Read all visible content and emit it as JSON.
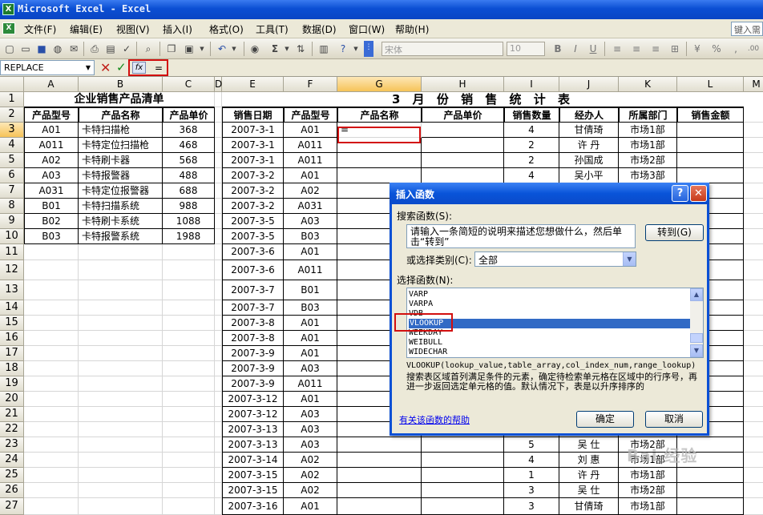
{
  "window": {
    "title": "Microsoft Excel - Excel",
    "app_icon": "excel-icon"
  },
  "menu": [
    "文件(F)",
    "编辑(E)",
    "视图(V)",
    "插入(I)",
    "格式(O)",
    "工具(T)",
    "数据(D)",
    "窗口(W)",
    "帮助(H)"
  ],
  "help_box": {
    "placeholder": "键入需"
  },
  "toolbar": {
    "font_name": "宋体",
    "font_size": "10",
    "icons": [
      "new-icon",
      "open-icon",
      "save-icon",
      "permission-icon",
      "email-icon",
      "print-icon",
      "print-preview-icon",
      "research-icon",
      "copy-icon",
      "paste-icon",
      "undo-icon",
      "hyperlink-icon",
      "autosum-icon",
      "sort-icon",
      "chart-icon",
      "help-icon",
      "bold-icon",
      "italic-icon",
      "underline-icon",
      "align-left-icon",
      "center-icon",
      "align-right-icon",
      "merge-center-icon",
      "currency-icon",
      "percent-icon",
      "comma-icon",
      "decimal-icon"
    ]
  },
  "formula_bar": {
    "name_box": "REPLACE",
    "cancel": "✕",
    "enter": "✓",
    "fx": "fx",
    "formula": "="
  },
  "columns": [
    "A",
    "B",
    "C",
    "D",
    "E",
    "F",
    "G",
    "H",
    "I",
    "J",
    "K",
    "L",
    "M"
  ],
  "rows": [
    "1",
    "2",
    "3",
    "4",
    "5",
    "6",
    "7",
    "8",
    "9",
    "10",
    "11",
    "12",
    "13",
    "14",
    "15",
    "16",
    "17",
    "18",
    "19",
    "20",
    "21",
    "22",
    "23",
    "24",
    "25",
    "26",
    "27"
  ],
  "left_table": {
    "title": "企业销售产品清单",
    "headers": [
      "产品型号",
      "产品名称",
      "产品单价"
    ],
    "rows": [
      [
        "A01",
        "卡特扫描枪",
        "368"
      ],
      [
        "A011",
        "卡特定位扫描枪",
        "468"
      ],
      [
        "A02",
        "卡特刷卡器",
        "568"
      ],
      [
        "A03",
        "卡特报警器",
        "488"
      ],
      [
        "A031",
        "卡特定位报警器",
        "688"
      ],
      [
        "B01",
        "卡特扫描系统",
        "988"
      ],
      [
        "B02",
        "卡特刷卡系统",
        "1088"
      ],
      [
        "B03",
        "卡特报警系统",
        "1988"
      ]
    ]
  },
  "right_table": {
    "title": "3 月 份 销 售 统 计 表",
    "headers": [
      "销售日期",
      "产品型号",
      "产品名称",
      "产品单价",
      "销售数量",
      "经办人",
      "所属部门",
      "销售金额"
    ],
    "active_cell_value": "=",
    "rows": [
      [
        "2007-3-1",
        "A01",
        "",
        "",
        "4",
        "甘倩琦",
        "市场1部",
        ""
      ],
      [
        "2007-3-1",
        "A011",
        "",
        "",
        "2",
        "许  丹",
        "市场1部",
        ""
      ],
      [
        "2007-3-1",
        "A011",
        "",
        "",
        "2",
        "孙国成",
        "市场2部",
        ""
      ],
      [
        "2007-3-2",
        "A01",
        "",
        "",
        "4",
        "吴小平",
        "市场3部",
        ""
      ],
      [
        "2007-3-2",
        "A02",
        "",
        "",
        "",
        "",
        "",
        ""
      ],
      [
        "2007-3-2",
        "A031",
        "",
        "",
        "",
        "",
        "",
        ""
      ],
      [
        "2007-3-5",
        "A03",
        "",
        "",
        "",
        "",
        "",
        ""
      ],
      [
        "2007-3-5",
        "B03",
        "",
        "",
        "",
        "",
        "",
        ""
      ],
      [
        "2007-3-6",
        "A01",
        "",
        "",
        "",
        "",
        "",
        ""
      ],
      [
        "2007-3-6",
        "A011",
        "",
        "",
        "",
        "",
        "",
        ""
      ],
      [
        "2007-3-7",
        "B01",
        "",
        "",
        "",
        "",
        "",
        ""
      ],
      [
        "2007-3-7",
        "B03",
        "",
        "",
        "",
        "",
        "",
        ""
      ],
      [
        "2007-3-8",
        "A01",
        "",
        "",
        "",
        "",
        "",
        ""
      ],
      [
        "2007-3-8",
        "A01",
        "",
        "",
        "",
        "",
        "",
        ""
      ],
      [
        "2007-3-9",
        "A01",
        "",
        "",
        "",
        "",
        "",
        ""
      ],
      [
        "2007-3-9",
        "A03",
        "",
        "",
        "",
        "",
        "",
        ""
      ],
      [
        "2007-3-9",
        "A011",
        "",
        "",
        "",
        "",
        "",
        ""
      ],
      [
        "2007-3-12",
        "A01",
        "",
        "",
        "",
        "",
        "",
        ""
      ],
      [
        "2007-3-12",
        "A03",
        "",
        "",
        "",
        "",
        "",
        ""
      ],
      [
        "2007-3-13",
        "A03",
        "",
        "",
        "",
        "",
        "",
        ""
      ],
      [
        "2007-3-13",
        "A03",
        "",
        "",
        "5",
        "吴  仕",
        "市场2部",
        ""
      ],
      [
        "2007-3-14",
        "A02",
        "",
        "",
        "4",
        "刘  惠",
        "市场1部",
        ""
      ],
      [
        "2007-3-15",
        "A02",
        "",
        "",
        "1",
        "许  丹",
        "市场1部",
        ""
      ],
      [
        "2007-3-15",
        "A02",
        "",
        "",
        "3",
        "吴  仕",
        "市场2部",
        ""
      ],
      [
        "2007-3-16",
        "A01",
        "",
        "",
        "3",
        "甘倩琦",
        "市场1部",
        ""
      ]
    ]
  },
  "dialog": {
    "title": "插入函数",
    "help_btn": "?",
    "close_btn": "✕",
    "search_label": "搜索函数(S):",
    "search_value": "请输入一条简短的说明来描述您想做什么，然后单击“转到”",
    "goto_label": "转到(G)",
    "category_label": "或选择类别(C):",
    "category_value": "全部",
    "select_label": "选择函数(N):",
    "functions": [
      "VARP",
      "VARPA",
      "VDB",
      "VLOOKUP",
      "WEEKDAY",
      "WEIBULL",
      "WIDECHAR"
    ],
    "selected_function": "VLOOKUP",
    "signature": "VLOOKUP(lookup_value,table_array,col_index_num,range_lookup)",
    "description": "搜索表区域首列满足条件的元素，确定待检索单元格在区域中的行序号，再进一步返回选定单元格的值。默认情况下，表是以升序排序的",
    "help_link": "有关该函数的帮助",
    "ok_label": "确定",
    "cancel_label": "取消"
  },
  "watermark": "Bai 经验"
}
